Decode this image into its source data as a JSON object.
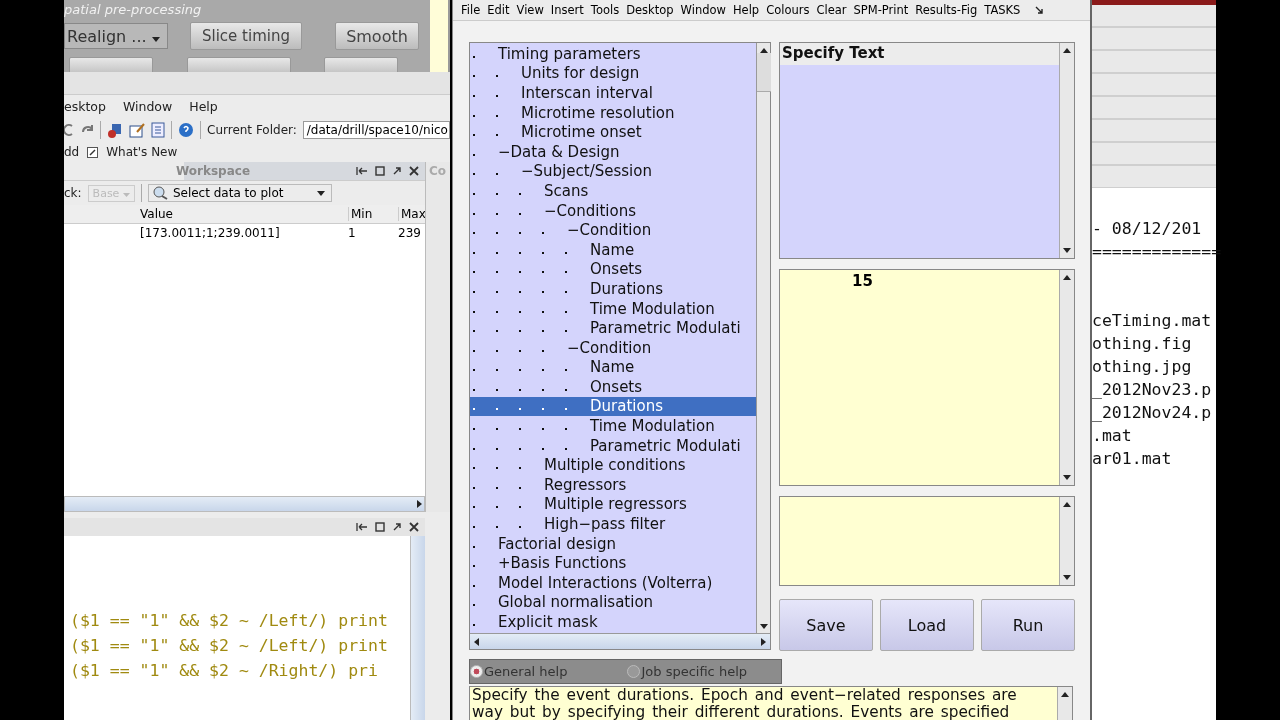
{
  "spm_panel": {
    "title": "patial pre-processing",
    "buttons": [
      {
        "label": "Realign  ...",
        "kind": "dropdown"
      },
      {
        "label": "Slice timing",
        "kind": "button"
      },
      {
        "label": "Smooth",
        "kind": "button"
      }
    ]
  },
  "matlab": {
    "menu": [
      "esktop",
      "Window",
      "Help"
    ],
    "current_folder_label": "Current Folder:",
    "current_folder": "/data/drill/space10/nico",
    "shortcuts": [
      "dd",
      "What's New"
    ],
    "workspace": {
      "title": "Workspace",
      "stack_label": "ck:",
      "stack_value": "Base",
      "plot_selector": "Select data to plot",
      "columns": [
        "Value",
        "Min",
        "Max"
      ],
      "rows": [
        [
          "[173.0011;1;239.0011]",
          "1",
          "239"
        ]
      ]
    },
    "side_tab": "Co",
    "command_lines": [
      "($1 == \"1\" && $2 ~ /Left/) print",
      "($1 == \"1\" && $2 ~ /Left/) print",
      "($1 == \"1\" && $2 ~ /Right/) pri"
    ]
  },
  "batch_editor": {
    "menu": [
      "File",
      "Edit",
      "View",
      "Insert",
      "Tools",
      "Desktop",
      "Window",
      "Help",
      "Colours",
      "Clear",
      "SPM-Print",
      "Results-Fig",
      "TASKS"
    ],
    "tree": [
      {
        "label": "Timing parameters",
        "selected": false,
        "children": [
          {
            "label": "Units for design",
            "selected": false
          },
          {
            "label": "Interscan interval",
            "selected": false
          },
          {
            "label": "Microtime resolution",
            "selected": false
          },
          {
            "label": "Microtime onset",
            "selected": false
          }
        ]
      },
      {
        "label": "−Data & Design",
        "selected": false,
        "children": [
          {
            "label": "−Subject/Session",
            "selected": false,
            "children": [
              {
                "label": "Scans",
                "selected": false
              },
              {
                "label": "−Conditions",
                "selected": false,
                "children": [
                  {
                    "label": "−Condition",
                    "selected": false,
                    "children": [
                      {
                        "label": "Name",
                        "selected": false
                      },
                      {
                        "label": "Onsets",
                        "selected": false
                      },
                      {
                        "label": "Durations",
                        "selected": false
                      },
                      {
                        "label": "Time Modulation",
                        "selected": false
                      },
                      {
                        "label": "Parametric Modulati",
                        "selected": false
                      }
                    ]
                  },
                  {
                    "label": "−Condition",
                    "selected": false,
                    "children": [
                      {
                        "label": "Name",
                        "selected": false
                      },
                      {
                        "label": "Onsets",
                        "selected": false
                      },
                      {
                        "label": "Durations",
                        "selected": true
                      },
                      {
                        "label": "Time Modulation",
                        "selected": false
                      },
                      {
                        "label": "Parametric Modulati",
                        "selected": false
                      }
                    ]
                  }
                ]
              },
              {
                "label": "Multiple conditions",
                "selected": false
              },
              {
                "label": "Regressors",
                "selected": false
              },
              {
                "label": "Multiple regressors",
                "selected": false
              },
              {
                "label": "High−pass filter",
                "selected": false
              }
            ]
          }
        ]
      },
      {
        "label": "Factorial design",
        "selected": false
      },
      {
        "label": "+Basis Functions",
        "selected": false
      },
      {
        "label": "Model Interactions (Volterra)",
        "selected": false
      },
      {
        "label": "Global normalisation",
        "selected": false
      },
      {
        "label": "Explicit mask",
        "selected": false
      }
    ],
    "text_panel_title": "Specify Text",
    "value_text": "15",
    "buttons": [
      "Save",
      "Load",
      "Run"
    ],
    "help_options": [
      {
        "label": "General help",
        "selected": true
      },
      {
        "label": "Job specific help",
        "selected": false
      }
    ],
    "help_text": [
      "Specify the  event  durations. Epoch and event−related responses are",
      "way  but  by  specifying their different durations. Events are specified"
    ]
  },
  "output_window": {
    "lines": [
      " - 08/12/201",
      "=============",
      "ceTiming.mat",
      "othing.fig",
      "othing.jpg",
      "_2012Nov23.p",
      "_2012Nov24.p",
      ".mat",
      "ar01.mat"
    ]
  }
}
